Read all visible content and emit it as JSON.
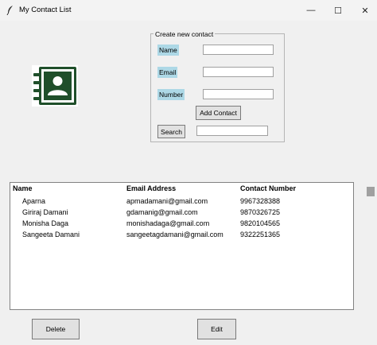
{
  "window": {
    "title": "My Contact List",
    "minimize": "—",
    "maximize": "☐",
    "close": "✕"
  },
  "form": {
    "group_title": "Create new contact",
    "name_label": "Name",
    "email_label": "Email",
    "number_label": "Number",
    "name_value": "",
    "email_value": "",
    "number_value": "",
    "add_button": "Add Contact",
    "search_button": "Search",
    "search_value": ""
  },
  "table": {
    "columns": [
      "Name",
      "Email Address",
      "Contact Number"
    ],
    "rows": [
      [
        "Aparna",
        "apmadamani@gmail.com",
        "9967328388"
      ],
      [
        "Giriraj Damani",
        "gdamanig@gmail.com",
        "9870326725"
      ],
      [
        "Monisha Daga",
        "monishadaga@gmail.com",
        "9820104565"
      ],
      [
        "Sangeeta Damani",
        "sangeetagdamani@gmail.com",
        "9322251365"
      ]
    ]
  },
  "actions": {
    "delete": "Delete",
    "edit": "Edit"
  },
  "colors": {
    "label_bg": "#add8e6",
    "icon": "#1f4f2a"
  }
}
